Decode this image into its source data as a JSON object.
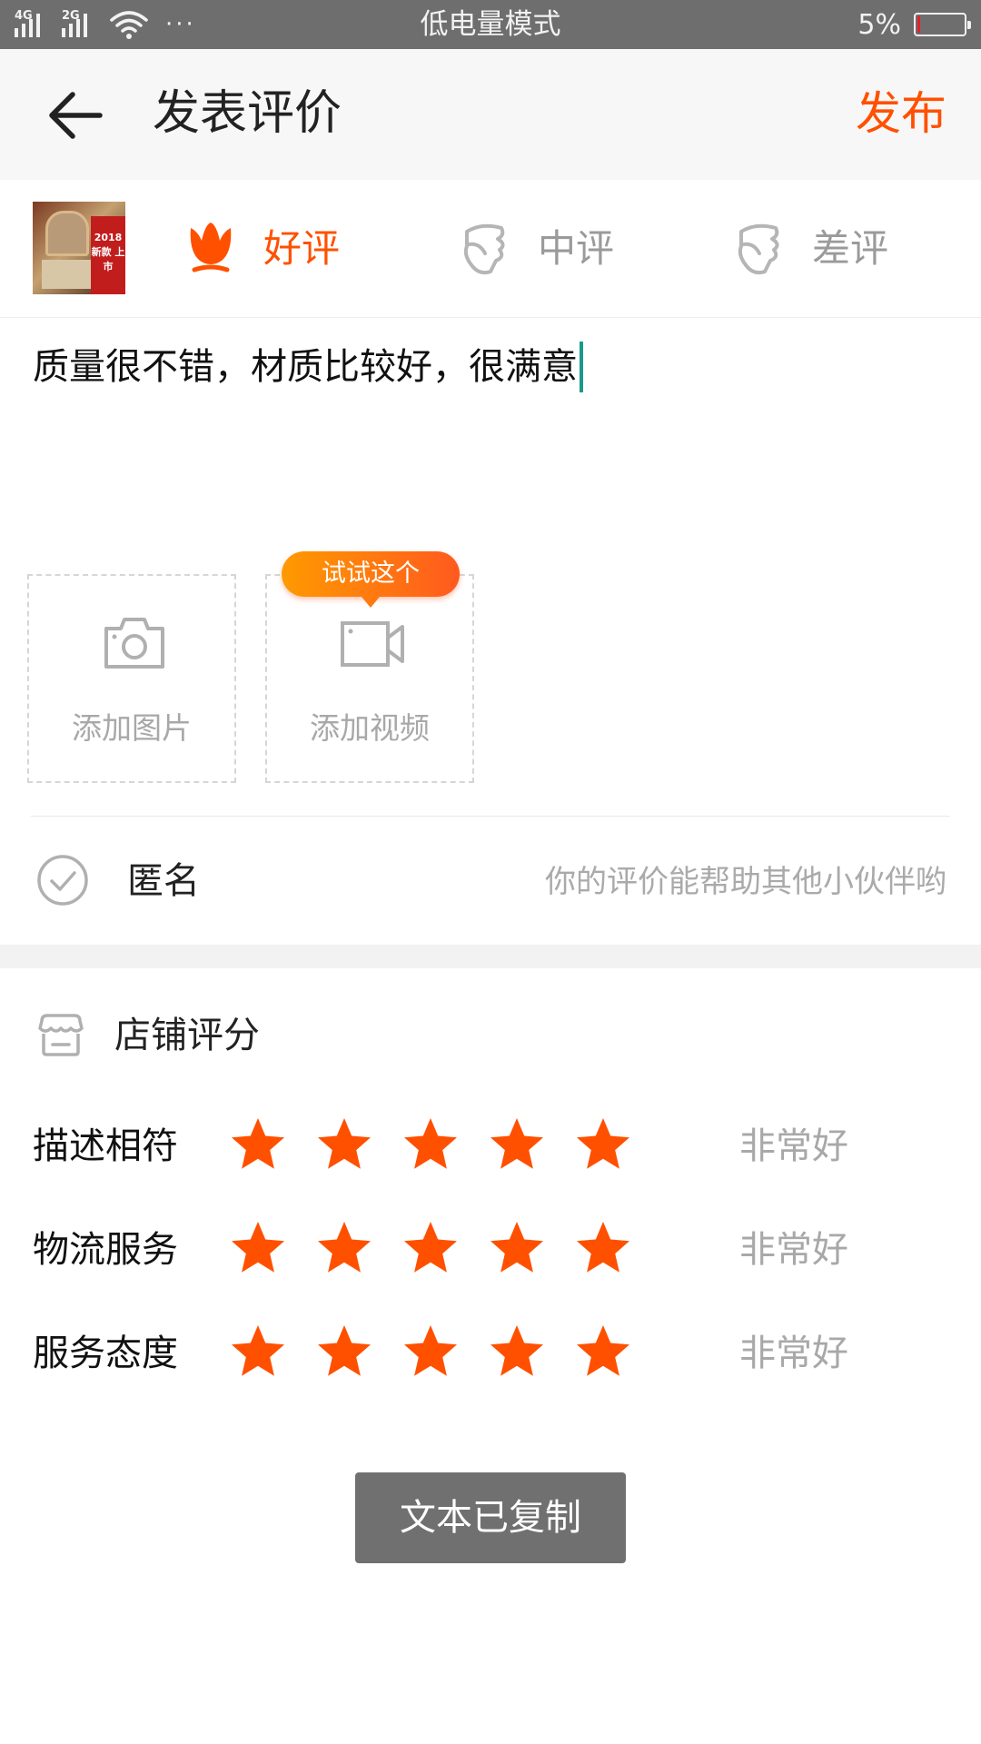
{
  "status_bar": {
    "network_1": "4G",
    "network_2": "2G",
    "more": "···",
    "mode": "低电量模式",
    "battery_percent": "5%",
    "battery_level": 0.05
  },
  "header": {
    "title": "发表评价",
    "publish_label": "发布"
  },
  "product": {
    "thumb_text": "2018 新款 上市"
  },
  "rating_tabs": [
    {
      "label": "好评",
      "selected": true
    },
    {
      "label": "中评",
      "selected": false
    },
    {
      "label": "差评",
      "selected": false
    }
  ],
  "review": {
    "text": "质量很不错，材质比较好，很满意"
  },
  "media": {
    "add_photo": "添加图片",
    "add_video": "添加视频",
    "tooltip": "试试这个"
  },
  "anonymous": {
    "label": "匿名",
    "hint": "你的评价能帮助其他小伙伴哟"
  },
  "shop_rating": {
    "title": "店铺评分",
    "rows": [
      {
        "label": "描述相符",
        "stars": 5,
        "max": 5,
        "text": "非常好"
      },
      {
        "label": "物流服务",
        "stars": 5,
        "max": 5,
        "text": "非常好"
      },
      {
        "label": "服务态度",
        "stars": 5,
        "max": 5,
        "text": "非常好"
      }
    ]
  },
  "toast": {
    "text": "文本已复制"
  },
  "colors": {
    "accent": "#ff5000",
    "star": "#ff5000",
    "muted": "#a8a8a8",
    "status_bar": "#6e6e6e"
  }
}
